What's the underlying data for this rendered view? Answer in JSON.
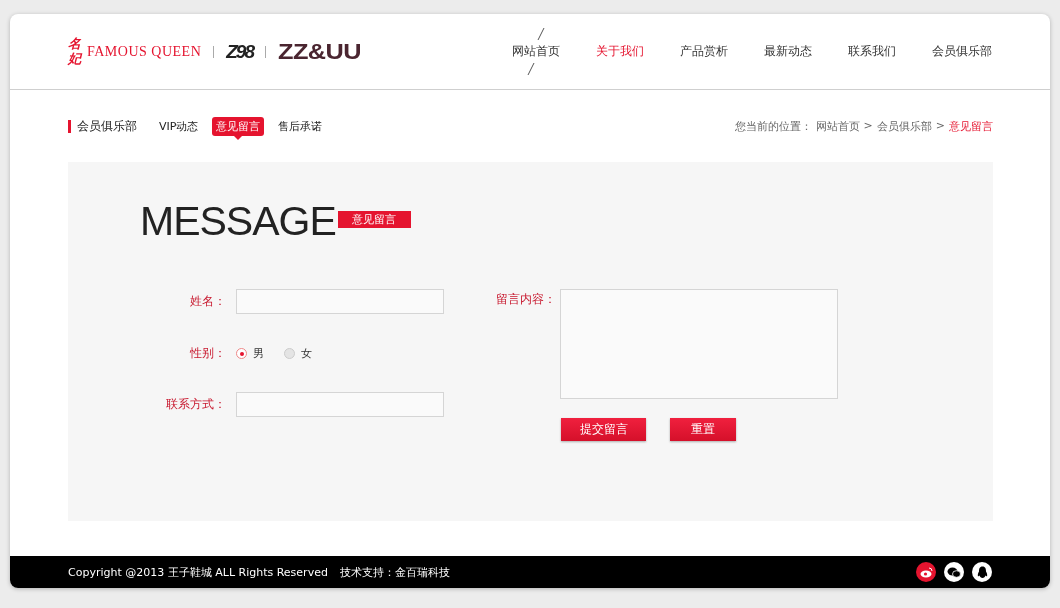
{
  "logos": {
    "brand_cn": "名妃",
    "brand_en": "FAMOUS QUEEN",
    "brand_2": "Z98",
    "brand_3": "ZZ&UU"
  },
  "nav": [
    {
      "label": "网站首页",
      "selected": false,
      "marked": true
    },
    {
      "label": "关于我们",
      "selected": true,
      "marked": false
    },
    {
      "label": "产品赏析",
      "selected": false,
      "marked": false
    },
    {
      "label": "最新动态",
      "selected": false,
      "marked": false
    },
    {
      "label": "联系我们",
      "selected": false,
      "marked": false
    },
    {
      "label": "会员俱乐部",
      "selected": false,
      "marked": false
    }
  ],
  "section_title": "会员俱乐部",
  "subnav": [
    {
      "label": "VIP动态",
      "selected": false
    },
    {
      "label": "意见留言",
      "selected": true
    },
    {
      "label": "售后承诺",
      "selected": false
    }
  ],
  "breadcrumb": {
    "prefix": "您当前的位置：",
    "separator": ">",
    "items": [
      {
        "label": "网站首页",
        "current": false
      },
      {
        "label": "会员俱乐部",
        "current": false
      },
      {
        "label": "意见留言",
        "current": true
      }
    ]
  },
  "heading": {
    "title": "MESSAGE",
    "badge": "意见留言"
  },
  "form": {
    "name_label": "姓名：",
    "gender_label": "性别：",
    "genders": [
      {
        "label": "男",
        "selected": true
      },
      {
        "label": "女",
        "selected": false
      }
    ],
    "contact_label": "联系方式：",
    "message_label": "留言内容：",
    "submit": "提交留言",
    "reset": "重置"
  },
  "footer": {
    "copyright": "Copyright @2013 王子鞋城 ALL Rights Reserved",
    "support": "技术支持：金百瑞科技"
  }
}
